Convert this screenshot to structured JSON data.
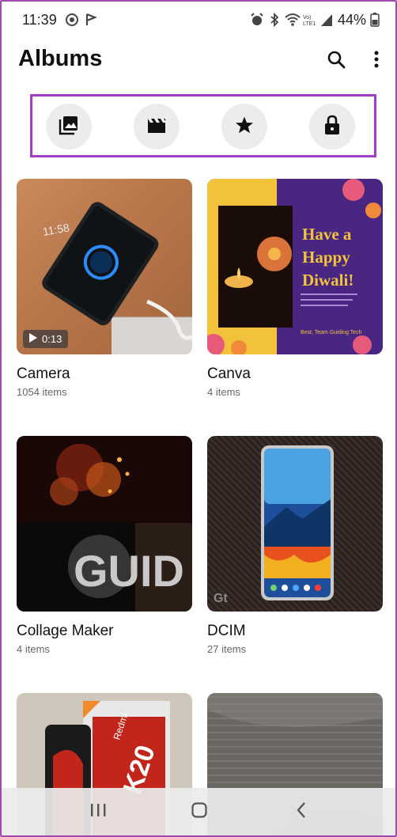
{
  "status_bar": {
    "time": "11:39",
    "battery_percent": "44%"
  },
  "header": {
    "title": "Albums"
  },
  "quick_filters": [
    {
      "icon": "photos-icon"
    },
    {
      "icon": "videos-icon"
    },
    {
      "icon": "favorites-star-icon"
    },
    {
      "icon": "secure-lock-icon"
    }
  ],
  "albums": [
    {
      "name": "Camera",
      "count": "1054 items",
      "video_duration": "0:13"
    },
    {
      "name": "Canva",
      "count": "4 items"
    },
    {
      "name": "Collage Maker",
      "count": "4 items"
    },
    {
      "name": "DCIM",
      "count": "27 items"
    },
    {
      "name": "",
      "count": ""
    },
    {
      "name": "",
      "count": ""
    }
  ],
  "canva_thumb": {
    "line1": "Have a",
    "line2": "Happy",
    "line3": "Diwali!",
    "caption": "Best,\nTeam Guiding Tech"
  },
  "camera_thumb": {
    "phone_clock": "11:58"
  },
  "k20_thumb": {
    "brand": "Redmi",
    "model": "K20"
  },
  "collage_thumb": {
    "sign": "GUID"
  },
  "colors": {
    "accent_border": "#a43cc6",
    "filter_bg": "#ececec"
  }
}
